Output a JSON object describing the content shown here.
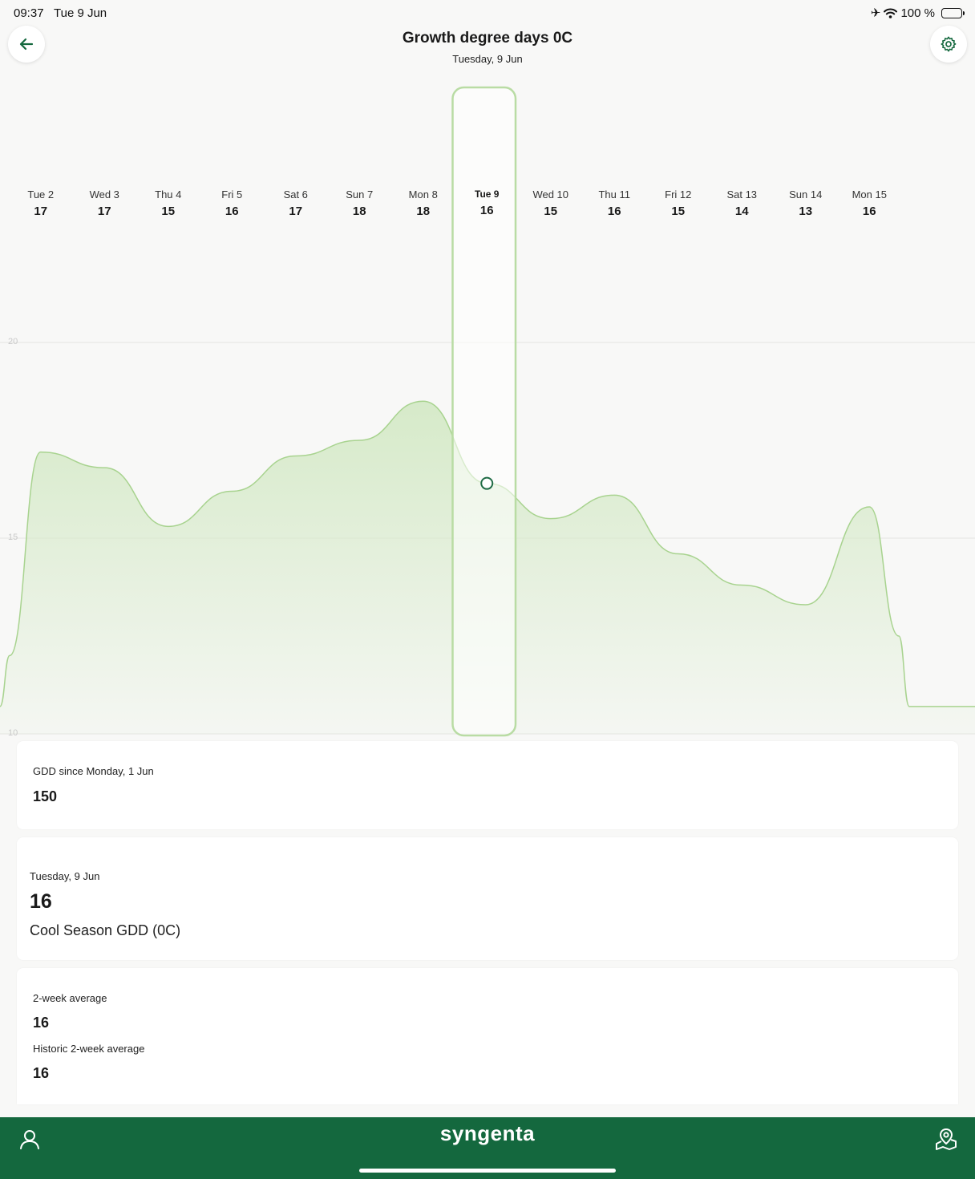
{
  "status_bar": {
    "time": "09:37",
    "date": "Tue 9 Jun",
    "battery": "100 %",
    "icons": [
      "airplane-icon",
      "wifi-icon",
      "battery-icon"
    ]
  },
  "header": {
    "title": "Growth degree days 0C",
    "subtitle": "Tuesday, 9 Jun",
    "back_icon": "arrow-left-icon",
    "settings_icon": "gear-icon"
  },
  "chart_data": {
    "type": "area",
    "title": "",
    "xlabel": "",
    "ylabel": "",
    "ylim": [
      10,
      26.5
    ],
    "yticks": [
      20,
      15,
      10
    ],
    "grid": true,
    "selected_index": 7,
    "categories": [
      "Tue 2",
      "Wed 3",
      "Thu 4",
      "Fri 5",
      "Sat 6",
      "Sun 7",
      "Mon 8",
      "Tue 9",
      "Wed 10",
      "Thu 11",
      "Fri 12",
      "Sat 13",
      "Sun 14",
      "Mon 15"
    ],
    "labels": [
      "17",
      "17",
      "15",
      "16",
      "17",
      "18",
      "18",
      "16",
      "15",
      "16",
      "15",
      "14",
      "13",
      "16"
    ],
    "series": [
      {
        "values": [
          17.2,
          16.8,
          15.3,
          16.2,
          17.1,
          17.5,
          18.5,
          16.4,
          15.5,
          16.1,
          14.6,
          13.8,
          13.3,
          15.8
        ]
      }
    ]
  },
  "cards": {
    "since": {
      "label": "GDD since Monday, 1 Jun",
      "value": "150"
    },
    "selected_day": {
      "date": "Tuesday, 9 Jun",
      "value": "16",
      "description": "Cool Season GDD (0C)"
    },
    "averages": {
      "two_week_label": "2-week average",
      "two_week_value": "16",
      "historic_label": "Historic 2-week average",
      "historic_value": "16"
    }
  },
  "bottom_bar": {
    "brand": "syngenta",
    "left_icon": "user-icon",
    "right_icon": "map-pin-icon"
  },
  "colors": {
    "brand_green": "#14683e",
    "area_fill": "#d6eac9",
    "line_green": "#a8d38f",
    "marker_green": "#1f6b45"
  }
}
